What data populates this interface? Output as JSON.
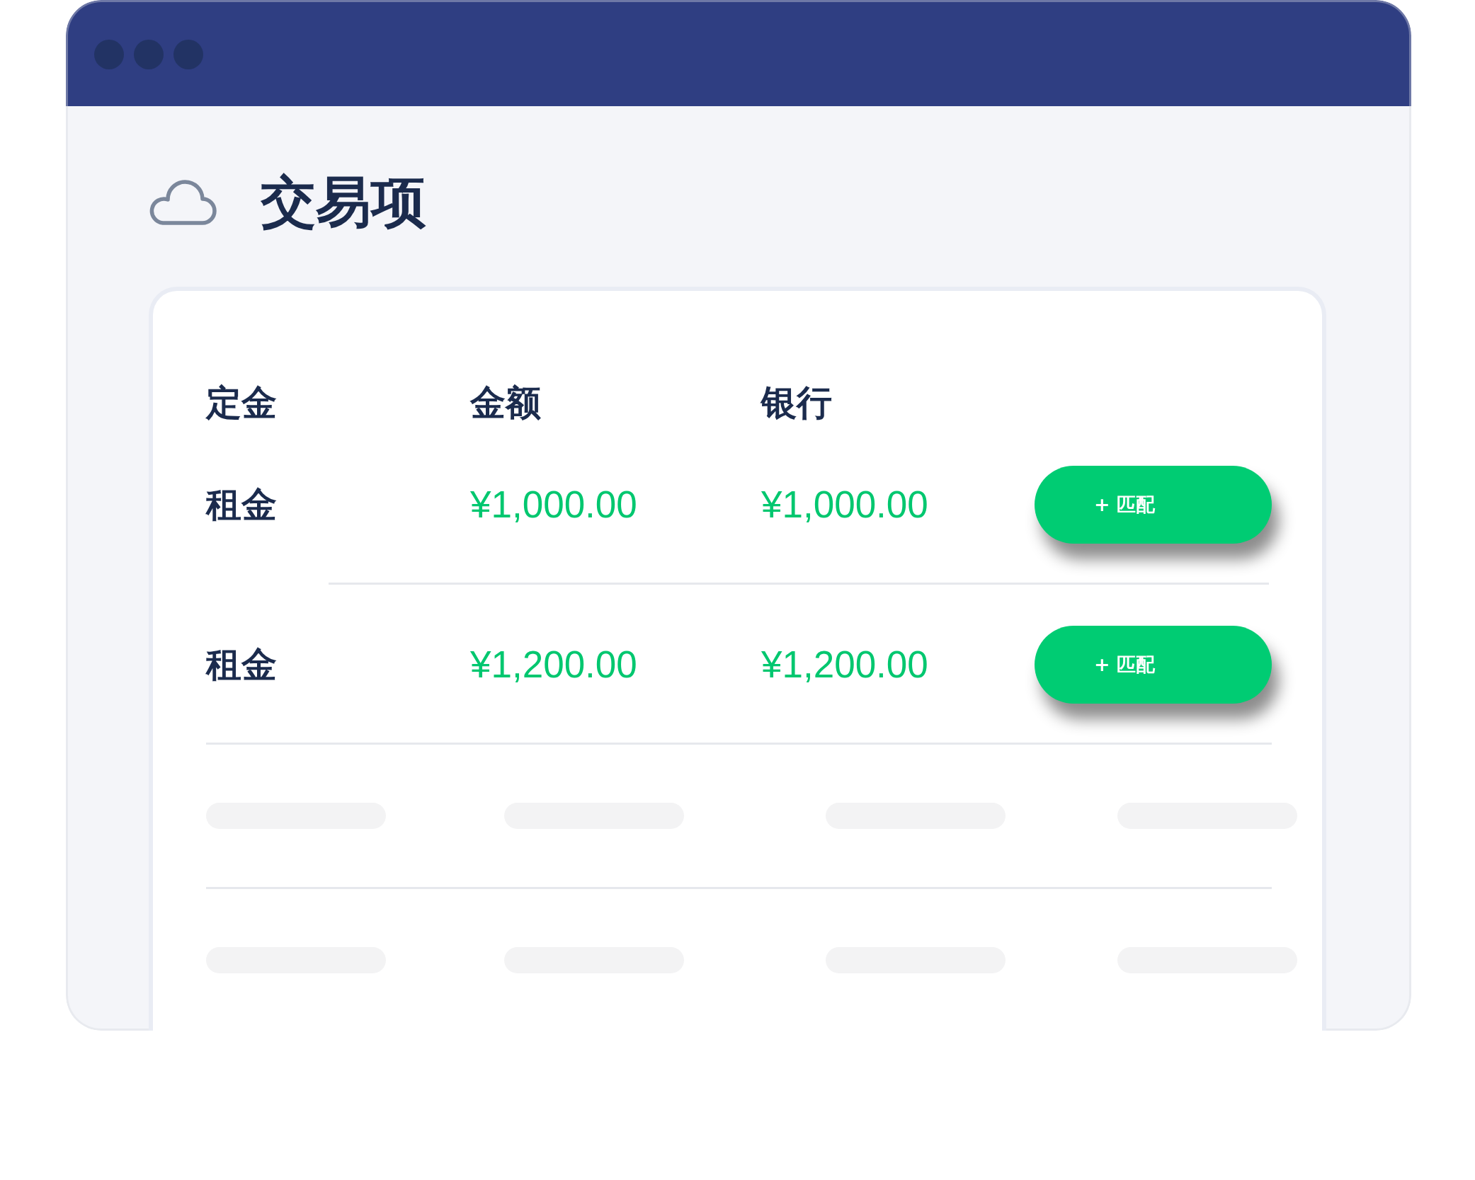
{
  "page": {
    "title": "交易项"
  },
  "table": {
    "columns": [
      "定金",
      "金额",
      "银行"
    ],
    "rows": [
      {
        "kind": "entry",
        "cells": [
          "租金",
          "¥1,000.00",
          "¥1,000.00"
        ],
        "action": "+ 匹配"
      },
      {
        "kind": "entry",
        "cells": [
          "租金",
          "¥1,200.00",
          "¥1,200.00"
        ],
        "action": "+ 匹配"
      },
      {
        "kind": "placeholder"
      },
      {
        "kind": "placeholder"
      }
    ]
  }
}
